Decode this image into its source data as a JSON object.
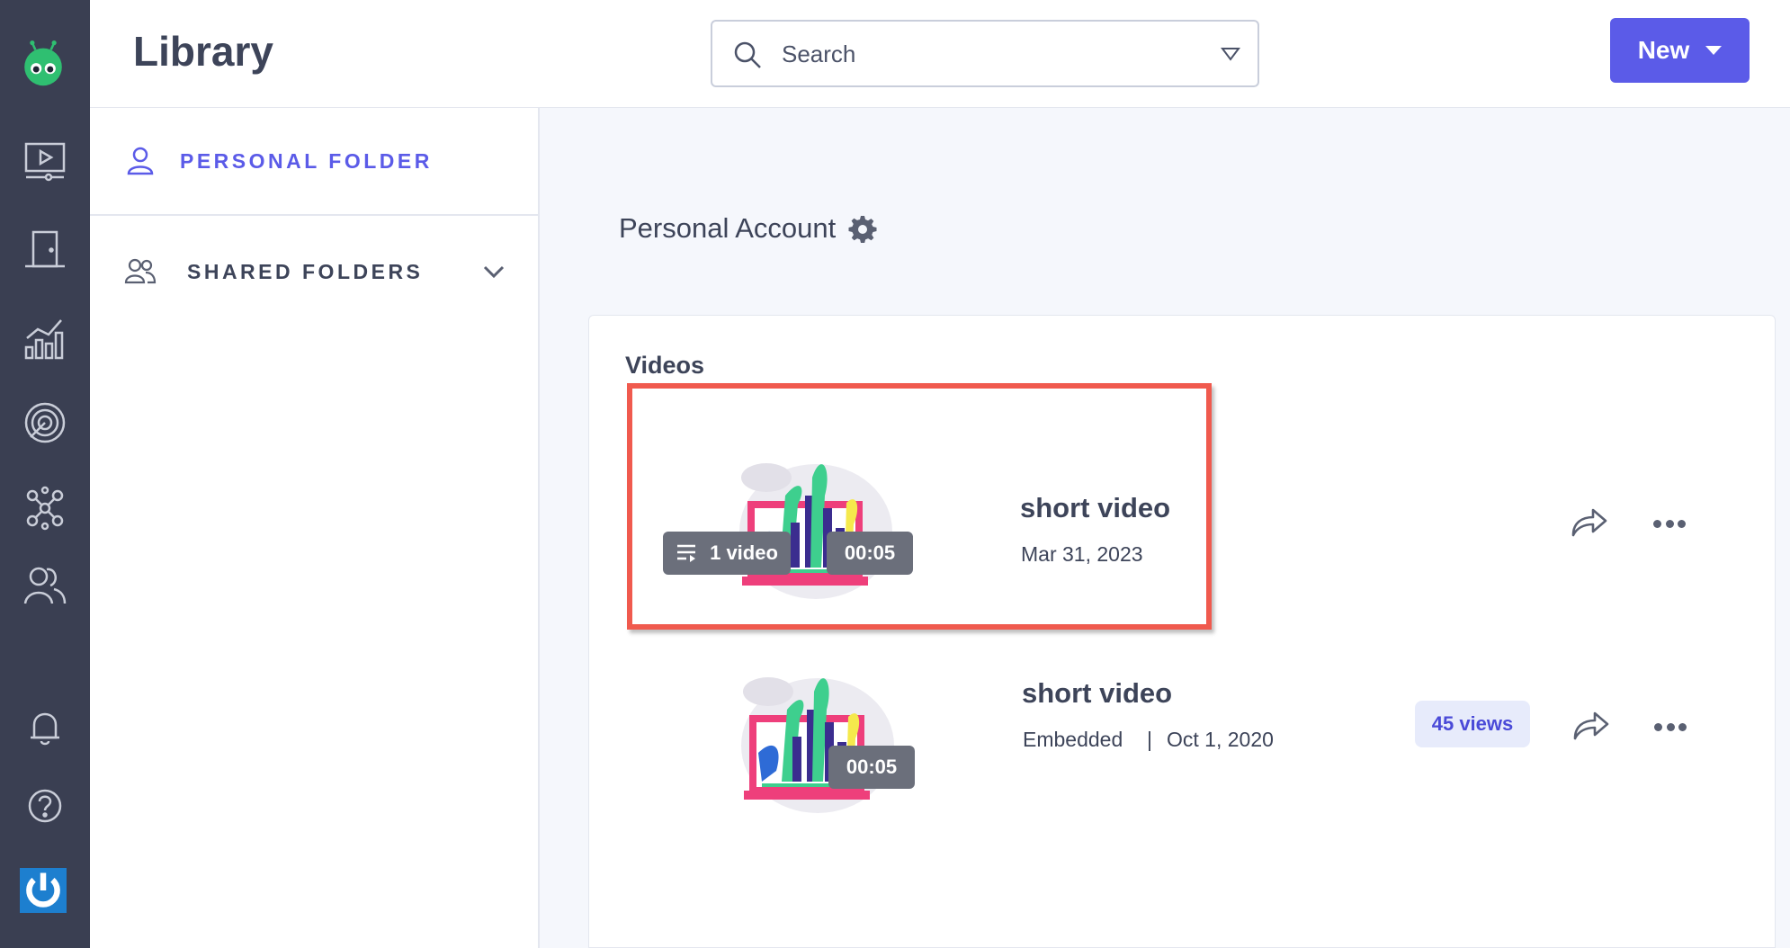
{
  "header": {
    "title": "Library",
    "search_placeholder": "Search",
    "new_label": "New"
  },
  "sidebar": {
    "personal_label": "PERSONAL FOLDER",
    "shared_label": "SHARED FOLDERS"
  },
  "main": {
    "account_name": "Personal Account",
    "section_title": "Videos",
    "videos": [
      {
        "title": "short video",
        "date": "Mar 31, 2023",
        "playlist": "1 video",
        "duration": "00:05"
      },
      {
        "title": "short video",
        "source": "Embedded",
        "separator": "|",
        "date": "Oct 1, 2020",
        "duration": "00:05",
        "views": "45 views"
      }
    ]
  },
  "colors": {
    "accent": "#5b5be8",
    "rail": "#3a3f52",
    "highlight": "#f05a4e"
  },
  "icons": [
    "logo-icon",
    "video-library-icon",
    "door-icon",
    "analytics-icon",
    "target-icon",
    "integrations-icon",
    "team-icon",
    "bell-icon",
    "help-icon",
    "power-icon",
    "search-icon",
    "user-icon",
    "users-icon",
    "chevron-down-icon",
    "gear-icon",
    "share-icon",
    "more-icon",
    "playlist-icon"
  ]
}
